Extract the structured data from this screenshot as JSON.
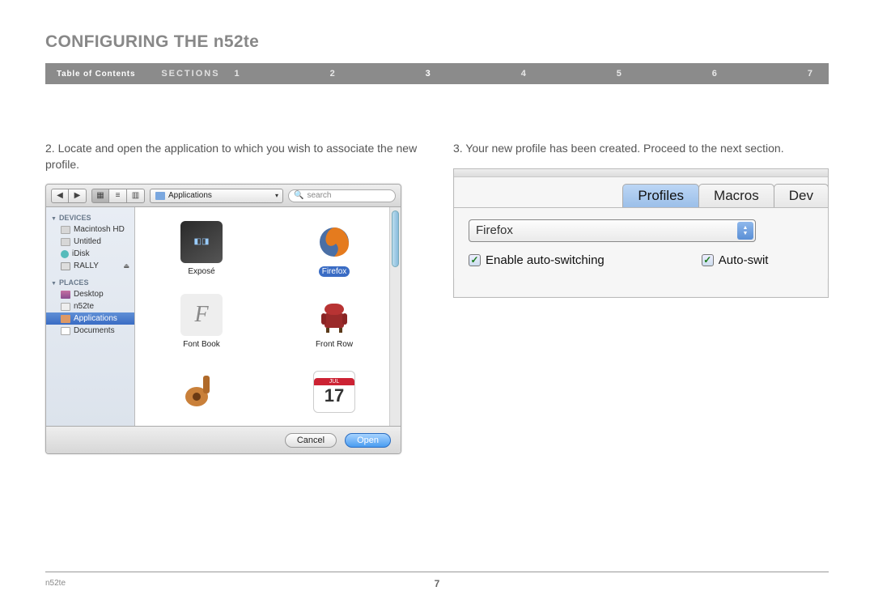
{
  "header": {
    "title": "CONFIGURING THE n52te",
    "toc": "Table of Contents",
    "sections": "SECTIONS",
    "nums": [
      "1",
      "2",
      "3",
      "4",
      "5",
      "6",
      "7"
    ],
    "active_num": "3"
  },
  "step2": {
    "text": "2. Locate and open the application to which you wish to associate the new profile."
  },
  "step3": {
    "text": "3. Your new profile has been created. Proceed to the next section."
  },
  "finder": {
    "location": "Applications",
    "search_placeholder": "search",
    "sidebar": {
      "devices_header": "DEVICES",
      "places_header": "PLACES",
      "devices": [
        {
          "label": "Macintosh HD",
          "icon": "sb-hd"
        },
        {
          "label": "Untitled",
          "icon": "sb-hd"
        },
        {
          "label": "iDisk",
          "icon": "sb-idisk"
        },
        {
          "label": "RALLY",
          "icon": "sb-drive",
          "eject": true
        }
      ],
      "places": [
        {
          "label": "Desktop",
          "icon": "sb-desktop"
        },
        {
          "label": "n52te",
          "icon": "sb-home"
        },
        {
          "label": "Applications",
          "icon": "sb-app",
          "selected": true
        },
        {
          "label": "Documents",
          "icon": "sb-doc"
        }
      ]
    },
    "apps": [
      {
        "label": "Exposé",
        "icon": "expose"
      },
      {
        "label": "Firefox",
        "icon": "firefox",
        "selected": true
      },
      {
        "label": "Font Book",
        "icon": "fontbook"
      },
      {
        "label": "Front Row",
        "icon": "frontrow"
      },
      {
        "label": "",
        "icon": "garage"
      },
      {
        "label": "",
        "icon": "ical"
      }
    ],
    "ical_day": "17",
    "ical_month": "JUL",
    "cancel": "Cancel",
    "open": "Open"
  },
  "profiles": {
    "tabs": [
      "Profiles",
      "Macros",
      "Dev"
    ],
    "active_tab": "Profiles",
    "selected": "Firefox",
    "check1": "Enable auto-switching",
    "check2": "Auto-swit"
  },
  "footer": {
    "product": "n52te",
    "page": "7"
  }
}
